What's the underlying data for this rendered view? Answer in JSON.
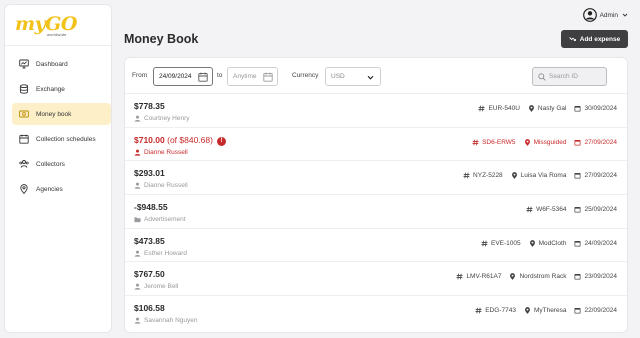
{
  "brand": {
    "logo_text": "myGO",
    "logo_sub": "worldwide"
  },
  "sidebar": {
    "items": [
      {
        "label": "Dashboard",
        "icon": "monitor-chart-icon",
        "active": false
      },
      {
        "label": "Exchange",
        "icon": "database-icon",
        "active": false
      },
      {
        "label": "Money book",
        "icon": "money-icon",
        "active": true
      },
      {
        "label": "Collection schedules",
        "icon": "calendar-icon",
        "active": false
      },
      {
        "label": "Collectors",
        "icon": "users-icon",
        "active": false
      },
      {
        "label": "Agencies",
        "icon": "location-pin-icon",
        "active": false
      }
    ]
  },
  "header": {
    "user_label": "Admin"
  },
  "page": {
    "title": "Money Book",
    "add_button": "Add expense"
  },
  "filters": {
    "from_label": "From",
    "from_value": "24/09/2024",
    "to_label": "to",
    "to_placeholder": "Anytime",
    "currency_label": "Currency",
    "currency_value": "USD",
    "search_placeholder": "Search ID"
  },
  "records": [
    {
      "amount": "$778.35",
      "extra": "",
      "person": "Courtney Henry",
      "person_type": "person",
      "id": "EUR-540U",
      "agency": "Nasty Gal",
      "date": "30/09/2024",
      "warning": false
    },
    {
      "amount": "$710.00",
      "extra": "(of $840.68)",
      "person": "Dianne Russell",
      "person_type": "person",
      "id": "SD6-ERW5",
      "agency": "Missguided",
      "date": "27/09/2024",
      "warning": true
    },
    {
      "amount": "$293.01",
      "extra": "",
      "person": "Dianne Russell",
      "person_type": "person",
      "id": "NYZ-5228",
      "agency": "Luisa Via Roma",
      "date": "27/09/2024",
      "warning": false
    },
    {
      "amount": "-$948.55",
      "extra": "",
      "person": "Advertisement",
      "person_type": "folder",
      "id": "W6F-5364",
      "agency": "",
      "date": "25/09/2024",
      "warning": false
    },
    {
      "amount": "$473.85",
      "extra": "",
      "person": "Esther Howard",
      "person_type": "person",
      "id": "EVE-1005",
      "agency": "ModCloth",
      "date": "24/09/2024",
      "warning": false
    },
    {
      "amount": "$767.50",
      "extra": "",
      "person": "Jerome Bell",
      "person_type": "person",
      "id": "LMV-R61A7",
      "agency": "Nordstrom Rack",
      "date": "23/09/2024",
      "warning": false
    },
    {
      "amount": "$106.58",
      "extra": "",
      "person": "Savannah Nguyen",
      "person_type": "person",
      "id": "EDG-7743",
      "agency": "MyTheresa",
      "date": "22/09/2024",
      "warning": false
    }
  ],
  "colors": {
    "accent": "#f2c21a",
    "active_bg": "#fdf0c9",
    "warning": "#c72a2a",
    "button": "#3f3f42"
  }
}
